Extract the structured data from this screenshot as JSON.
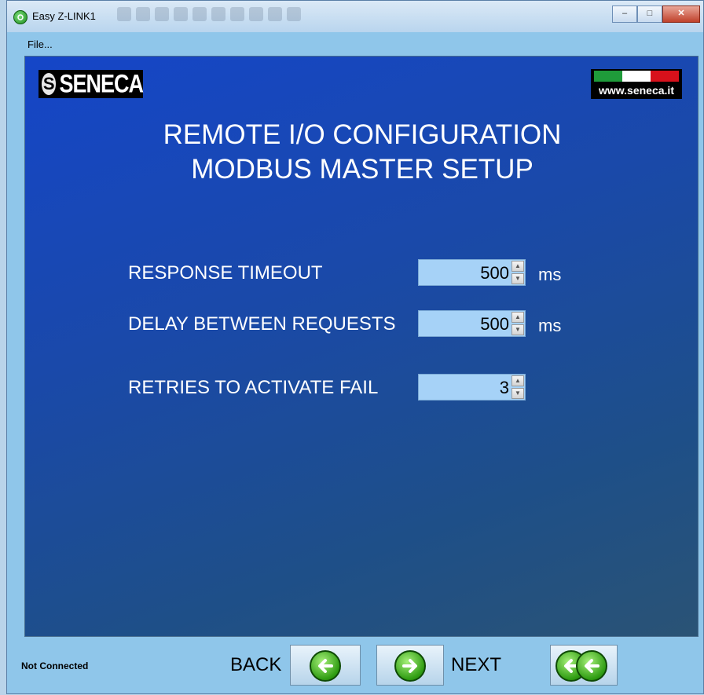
{
  "window": {
    "title": "Easy Z-LINK1"
  },
  "menu": {
    "file": "File..."
  },
  "brand": {
    "logo_text": "SENECA",
    "website": "www.seneca.it"
  },
  "heading": {
    "line1": "REMOTE I/O CONFIGURATION",
    "line2": "MODBUS MASTER SETUP"
  },
  "fields": [
    {
      "label": "RESPONSE TIMEOUT",
      "value": "500",
      "unit": "ms"
    },
    {
      "label": "DELAY BETWEEN REQUESTS",
      "value": "500",
      "unit": "ms"
    },
    {
      "label": "RETRIES TO ACTIVATE FAIL",
      "value": "3",
      "unit": ""
    }
  ],
  "status": {
    "connection": "Not Connected"
  },
  "nav": {
    "back": "BACK",
    "next": "NEXT"
  },
  "colors": {
    "panel": "#1546c8",
    "field_bg": "#a6d2f7",
    "window_bg": "#8fc6ea",
    "arrow_green": "#2f9c12"
  },
  "icons": [
    "app-icon",
    "back-arrow-icon",
    "next-arrow-icon",
    "home-double-back-icon",
    "minimize-icon",
    "maximize-icon",
    "close-icon"
  ]
}
